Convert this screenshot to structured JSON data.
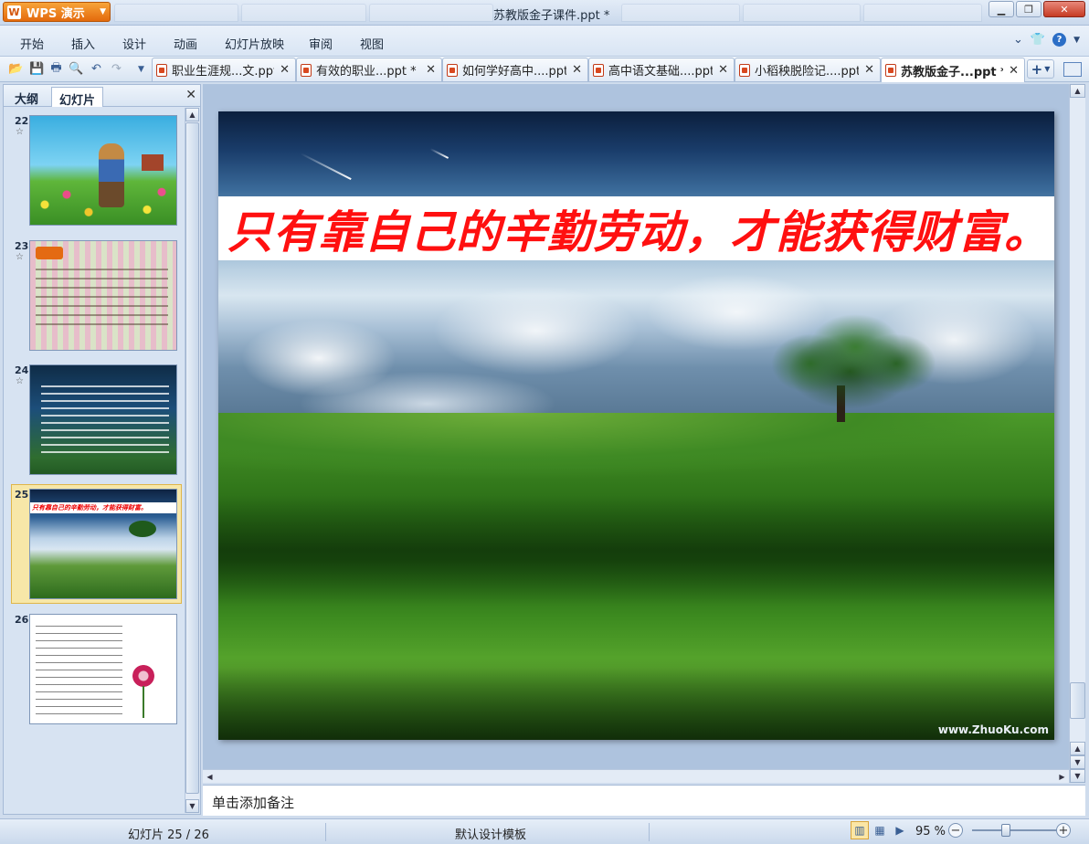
{
  "titlebar": {
    "app_button": "WPS 演示",
    "app_logo": "W",
    "window_title": "苏教版金子课件.ppt *",
    "controls": [
      "minimize",
      "restore",
      "close"
    ]
  },
  "menu": {
    "items": [
      "开始",
      "插入",
      "设计",
      "动画",
      "幻灯片放映",
      "审阅",
      "视图"
    ]
  },
  "doc_tabs": [
    {
      "label": "职业生涯规...文.ppt",
      "active": false
    },
    {
      "label": "有效的职业...ppt *",
      "active": false
    },
    {
      "label": "如何学好高中....ppt *",
      "active": false
    },
    {
      "label": "高中语文基础....ppt *",
      "active": false
    },
    {
      "label": "小稻秧脱险记....ppt *",
      "active": false
    },
    {
      "label": "苏教版金子...ppt *",
      "active": true
    }
  ],
  "left_panel": {
    "tabs": [
      "大纲",
      "幻灯片"
    ],
    "active_tab": "幻灯片",
    "thumbnails": [
      {
        "number": "22",
        "star": "☆"
      },
      {
        "number": "23",
        "star": "☆"
      },
      {
        "number": "24",
        "star": "☆"
      },
      {
        "number": "25",
        "star": "",
        "selected": true,
        "caption": "只有靠自己的辛勤劳动，才能获得财富。"
      },
      {
        "number": "26",
        "star": ""
      }
    ]
  },
  "slide": {
    "title": "只有靠自己的辛勤劳动，才能获得财富。",
    "watermark": "www.ZhuoKu.com",
    "title_color": "#ff1010"
  },
  "notes": {
    "placeholder": "单击添加备注"
  },
  "status": {
    "slide_counter": "幻灯片 25 / 26",
    "template": "默认设计模板",
    "zoom": "95 %",
    "zoom_percent": 95
  }
}
